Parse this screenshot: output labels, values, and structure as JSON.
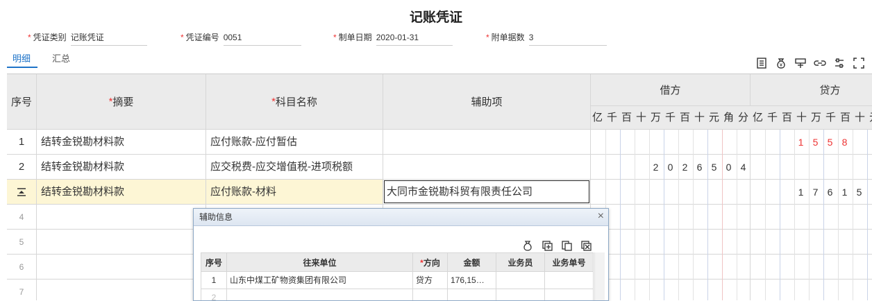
{
  "title": "记账凭证",
  "header": {
    "type_label": "凭证类别",
    "type_value": "记账凭证",
    "number_label": "凭证编号",
    "number_value": "0051",
    "date_label": "制单日期",
    "date_value": "2020-01-31",
    "attach_label": "附单据数",
    "attach_value": "3"
  },
  "tabs": [
    {
      "label": "明细"
    },
    {
      "label": "汇总"
    }
  ],
  "toolbar": [
    "insert-row-icon",
    "money-bag-icon",
    "sign-icon",
    "link-icon",
    "settings-icon",
    "fullscreen-icon"
  ],
  "columns": {
    "seq": "序号",
    "summary": "摘要",
    "account": "科目名称",
    "aux": "辅助项",
    "debit": "借方",
    "credit": "贷方",
    "units": [
      "亿",
      "千",
      "百",
      "十",
      "万",
      "千",
      "百",
      "十",
      "元",
      "角",
      "分"
    ]
  },
  "rows": [
    {
      "seq": "1",
      "summary": "结转金锐勘材料款",
      "account": "应付账款-应付暂估",
      "aux": "",
      "debit": "",
      "credit": "1558"
    },
    {
      "seq": "2",
      "summary": "结转金锐勘材料款",
      "account": "应交税费-应交增值税-进项税额",
      "aux": "",
      "debit": "2026504",
      "credit": ""
    },
    {
      "seq": "",
      "summary": "结转金锐勘材料款",
      "account": "应付账款-材料",
      "aux": "大同市金锐勘科贸有限责任公司",
      "debit": "",
      "credit": "17615"
    },
    {
      "seq": "4"
    },
    {
      "seq": "5"
    },
    {
      "seq": "6"
    },
    {
      "seq": "7"
    }
  ],
  "popup": {
    "title": "辅助信息",
    "close": "×",
    "headers": {
      "seq": "序号",
      "unit": "往来单位",
      "dir": "方向",
      "amount": "金额",
      "clerk": "业务员",
      "doc": "业务单号"
    },
    "rows": [
      {
        "seq": "1",
        "unit": "山东中煤工矿物资集团有限公司",
        "dir": "贷方",
        "amount": "176,15…",
        "clerk": "",
        "doc": ""
      },
      {
        "seq": "2",
        "unit": "",
        "dir": "",
        "amount": "",
        "clerk": "",
        "doc": ""
      }
    ]
  }
}
